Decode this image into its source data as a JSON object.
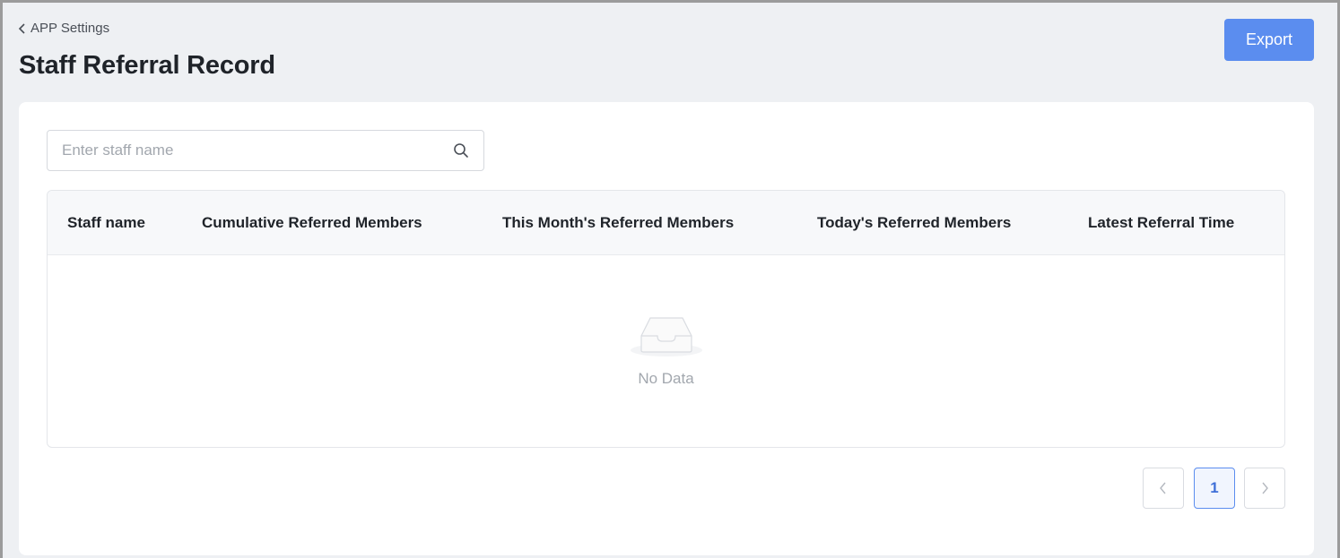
{
  "header": {
    "breadcrumb": "APP Settings",
    "title": "Staff Referral Record",
    "export_label": "Export"
  },
  "search": {
    "placeholder": "Enter staff name",
    "value": ""
  },
  "table": {
    "columns": [
      "Staff name",
      "Cumulative Referred Members",
      "This Month's Referred Members",
      "Today's Referred Members",
      "Latest Referral Time"
    ],
    "rows": [],
    "empty_text": "No Data"
  },
  "pagination": {
    "current_page": "1"
  },
  "icons": {
    "back": "chevron-left-icon",
    "search": "search-icon",
    "empty": "empty-inbox-icon",
    "prev": "chevron-left-icon",
    "next": "chevron-right-icon"
  },
  "colors": {
    "accent": "#5b8def",
    "background": "#eef0f3",
    "card": "#ffffff",
    "muted_text": "#a2a7ae"
  }
}
